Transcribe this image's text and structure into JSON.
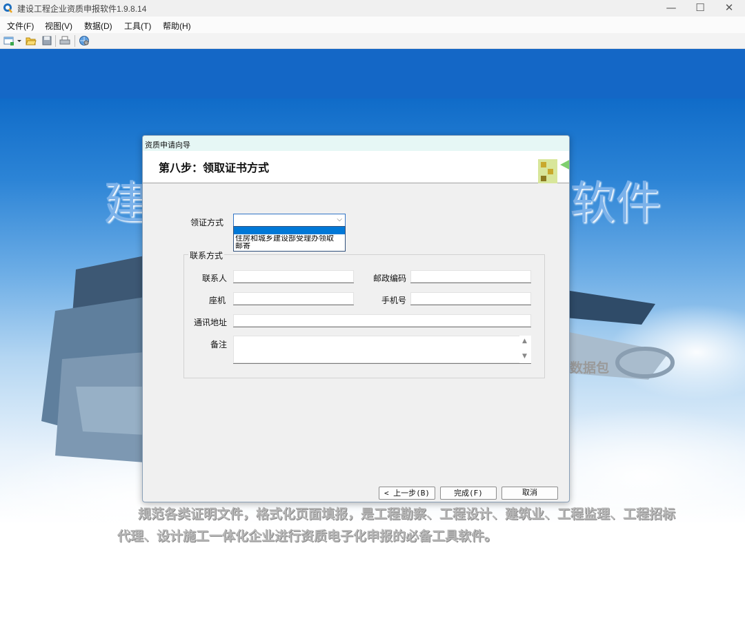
{
  "window": {
    "title": "建设工程企业资质申报软件1.9.8.14",
    "minimize_glyph": "—",
    "maximize_glyph": "☐",
    "close_glyph": "✕"
  },
  "menu": {
    "items": [
      "文件(F)",
      "视图(V)",
      "数据(D)",
      "工具(T)",
      "帮助(H)"
    ]
  },
  "toolbar": {
    "icons": [
      "new-file-icon",
      "dropdown-arrow-icon",
      "open-folder-icon",
      "save-icon",
      "print-icon",
      "globe-network-icon"
    ]
  },
  "background": {
    "big_text_left": "建",
    "big_text_right": "软件",
    "side_text": "数据包",
    "description": "规范各类证明文件，格式化页面填报，是工程勘察、工程设计、建筑业、工程监理、工程招标代理、设计施工一体化企业进行资质电子化申报的必备工具软件。"
  },
  "dialog": {
    "title": "资质申请向导",
    "step_title": "第八步：领取证书方式",
    "method_label": "领证方式",
    "method_value": "",
    "method_options": [
      "住房和城乡建设部受理办领取",
      "邮寄"
    ],
    "contact_group": "联系方式",
    "fields": {
      "contact_person": {
        "label": "联系人",
        "value": ""
      },
      "postal_code": {
        "label": "邮政编码",
        "value": ""
      },
      "landline": {
        "label": "座机",
        "value": ""
      },
      "mobile": {
        "label": "手机号",
        "value": ""
      },
      "address": {
        "label": "通讯地址",
        "value": ""
      },
      "remarks": {
        "label": "备注",
        "value": ""
      }
    },
    "buttons": {
      "prev": "< 上一步(B)",
      "finish": "完成(F)",
      "cancel": "取消"
    }
  },
  "colors": {
    "accent": "#0078d7",
    "dialog_title_bg": "#e6f7f5",
    "bg_blue": "#1467c6"
  }
}
